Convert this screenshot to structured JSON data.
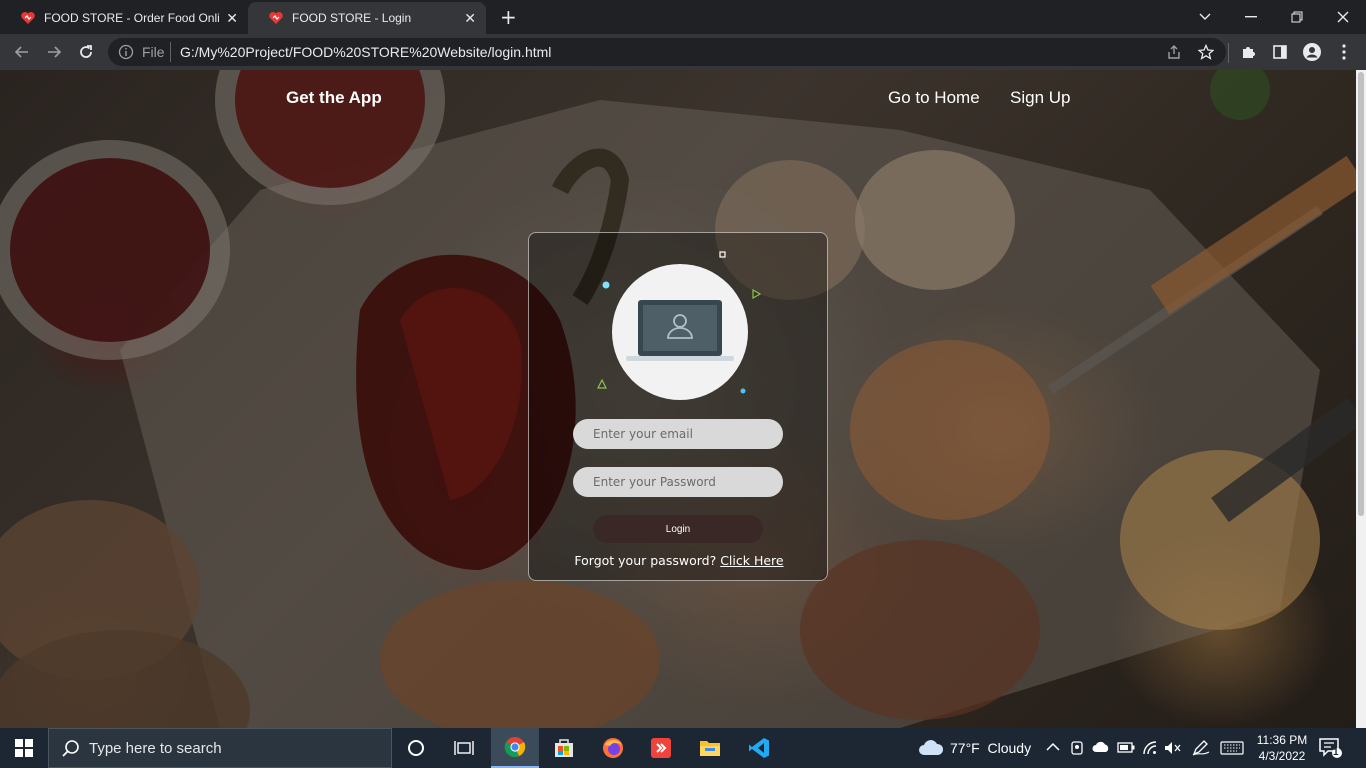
{
  "browser": {
    "tabs": [
      {
        "title": "FOOD STORE - Order Food Onlin",
        "active": false
      },
      {
        "title": "FOOD STORE - Login",
        "active": true
      }
    ],
    "address": {
      "scheme": "File",
      "url": "G:/My%20Project/FOOD%20STORE%20Website/login.html"
    },
    "icons": [
      "back-icon",
      "forward-icon",
      "reload-icon",
      "info-icon",
      "share-icon",
      "bookmark-star-icon",
      "extensions-icon",
      "side-panel-icon",
      "profile-icon",
      "menu-icon"
    ]
  },
  "site": {
    "nav": {
      "get_app": "Get the App",
      "home": "Go to Home",
      "signup": "Sign Up"
    },
    "login": {
      "email_placeholder": "Enter your email",
      "password_placeholder": "Enter your Password",
      "button": "Login",
      "forgot_text": "Forgot your password?",
      "forgot_link": "Click Here"
    }
  },
  "taskbar": {
    "search_placeholder": "Type here to search",
    "weather": {
      "temp": "77°F",
      "condition": "Cloudy"
    },
    "time": "11:36 PM",
    "date": "4/3/2022",
    "notifications": "1",
    "apps": [
      "cortana-icon",
      "task-view-icon",
      "chrome-icon",
      "store-icon",
      "firefox-icon",
      "anydesk-icon",
      "file-explorer-icon",
      "vscode-icon"
    ]
  },
  "colors": {
    "accent": "#8ab4f8",
    "login_button": "#3a2826",
    "field_bg": "#d9d9d9"
  }
}
